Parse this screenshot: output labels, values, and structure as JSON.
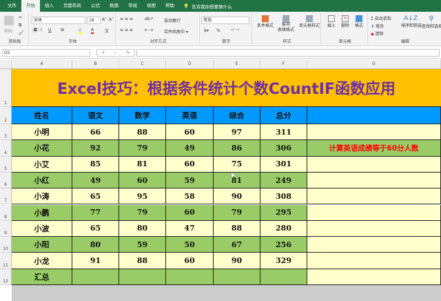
{
  "ribbon_tabs": [
    "文件",
    "开始",
    "插入",
    "页面布局",
    "公式",
    "数据",
    "审阅",
    "视图",
    "帮助"
  ],
  "active_tab": "开始",
  "tell_me": "告诉我你想要做什么",
  "ribbon": {
    "clipboard": {
      "label": "剪贴板",
      "paste": "粘贴"
    },
    "font": {
      "label": "字体",
      "font_name": "宋体",
      "font_size": "18",
      "bold": "B",
      "italic": "I",
      "underline": "U"
    },
    "alignment": {
      "label": "对齐方式",
      "wrap": "自动换行",
      "merge": "合并后居中"
    },
    "number": {
      "label": "数字",
      "format": "常规",
      "percent": "%"
    },
    "styles": {
      "label": "样式",
      "conditional": "条件格式",
      "table": "套用\n表格格式",
      "cell_styles": "单元格样式"
    },
    "cells": {
      "label": "单元格",
      "insert": "插入",
      "delete": "删除",
      "format": "格式"
    },
    "editing": {
      "label": "编辑",
      "autosum": "自动求和",
      "fill": "填充",
      "clear": "清除",
      "sort": "排序和筛选",
      "find": "查找和选择"
    }
  },
  "formula_bar": {
    "name_box": "G5",
    "formula": ""
  },
  "columns": [
    "A",
    "B",
    "C",
    "D",
    "E",
    "F",
    "G"
  ],
  "rows": [
    "1",
    "2",
    "3",
    "4",
    "5",
    "6",
    "7",
    "8",
    "9",
    "10",
    "11",
    "12"
  ],
  "sheet": {
    "title": "Excel技巧：根据条件统计个数CountIF函数应用",
    "headers": [
      "姓名",
      "语文",
      "数学",
      "英语",
      "综合",
      "总分"
    ],
    "data": [
      [
        "小明",
        "66",
        "88",
        "60",
        "97",
        "311"
      ],
      [
        "小花",
        "92",
        "79",
        "49",
        "86",
        "306"
      ],
      [
        "小艾",
        "85",
        "81",
        "60",
        "75",
        "301"
      ],
      [
        "小红",
        "49",
        "60",
        "59",
        "81",
        "249"
      ],
      [
        "小涛",
        "65",
        "95",
        "58",
        "90",
        "308"
      ],
      [
        "小鹏",
        "77",
        "79",
        "60",
        "79",
        "295"
      ],
      [
        "小波",
        "65",
        "80",
        "47",
        "88",
        "280"
      ],
      [
        "小阳",
        "80",
        "59",
        "50",
        "67",
        "256"
      ],
      [
        "小龙",
        "91",
        "88",
        "60",
        "90",
        "329"
      ],
      [
        "汇总",
        "",
        "",
        "",
        "",
        ""
      ]
    ],
    "note": "计算英语成绩等于60分人数"
  },
  "colors": {
    "title_bg": "#ffc000",
    "title_text": "#7030a0",
    "header_bg": "#0099ff",
    "row_light": "#ffffcc",
    "row_green": "#99cc66",
    "note": "#ff0000",
    "ribbon": "#217346"
  }
}
